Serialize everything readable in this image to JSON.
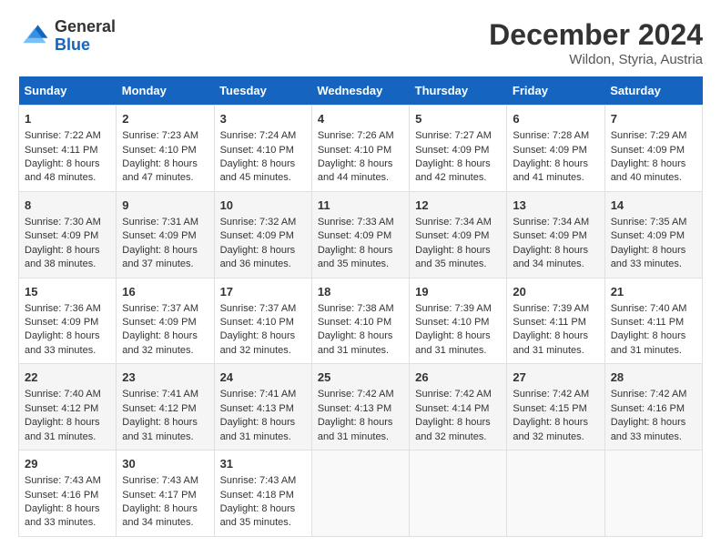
{
  "header": {
    "logo_line1": "General",
    "logo_line2": "Blue",
    "title": "December 2024",
    "subtitle": "Wildon, Styria, Austria"
  },
  "days_of_week": [
    "Sunday",
    "Monday",
    "Tuesday",
    "Wednesday",
    "Thursday",
    "Friday",
    "Saturday"
  ],
  "weeks": [
    [
      {
        "day": "1",
        "sunrise": "7:22 AM",
        "sunset": "4:11 PM",
        "daylight": "8 hours and 48 minutes."
      },
      {
        "day": "2",
        "sunrise": "7:23 AM",
        "sunset": "4:10 PM",
        "daylight": "8 hours and 47 minutes."
      },
      {
        "day": "3",
        "sunrise": "7:24 AM",
        "sunset": "4:10 PM",
        "daylight": "8 hours and 45 minutes."
      },
      {
        "day": "4",
        "sunrise": "7:26 AM",
        "sunset": "4:10 PM",
        "daylight": "8 hours and 44 minutes."
      },
      {
        "day": "5",
        "sunrise": "7:27 AM",
        "sunset": "4:09 PM",
        "daylight": "8 hours and 42 minutes."
      },
      {
        "day": "6",
        "sunrise": "7:28 AM",
        "sunset": "4:09 PM",
        "daylight": "8 hours and 41 minutes."
      },
      {
        "day": "7",
        "sunrise": "7:29 AM",
        "sunset": "4:09 PM",
        "daylight": "8 hours and 40 minutes."
      }
    ],
    [
      {
        "day": "8",
        "sunrise": "7:30 AM",
        "sunset": "4:09 PM",
        "daylight": "8 hours and 38 minutes."
      },
      {
        "day": "9",
        "sunrise": "7:31 AM",
        "sunset": "4:09 PM",
        "daylight": "8 hours and 37 minutes."
      },
      {
        "day": "10",
        "sunrise": "7:32 AM",
        "sunset": "4:09 PM",
        "daylight": "8 hours and 36 minutes."
      },
      {
        "day": "11",
        "sunrise": "7:33 AM",
        "sunset": "4:09 PM",
        "daylight": "8 hours and 35 minutes."
      },
      {
        "day": "12",
        "sunrise": "7:34 AM",
        "sunset": "4:09 PM",
        "daylight": "8 hours and 35 minutes."
      },
      {
        "day": "13",
        "sunrise": "7:34 AM",
        "sunset": "4:09 PM",
        "daylight": "8 hours and 34 minutes."
      },
      {
        "day": "14",
        "sunrise": "7:35 AM",
        "sunset": "4:09 PM",
        "daylight": "8 hours and 33 minutes."
      }
    ],
    [
      {
        "day": "15",
        "sunrise": "7:36 AM",
        "sunset": "4:09 PM",
        "daylight": "8 hours and 33 minutes."
      },
      {
        "day": "16",
        "sunrise": "7:37 AM",
        "sunset": "4:09 PM",
        "daylight": "8 hours and 32 minutes."
      },
      {
        "day": "17",
        "sunrise": "7:37 AM",
        "sunset": "4:10 PM",
        "daylight": "8 hours and 32 minutes."
      },
      {
        "day": "18",
        "sunrise": "7:38 AM",
        "sunset": "4:10 PM",
        "daylight": "8 hours and 31 minutes."
      },
      {
        "day": "19",
        "sunrise": "7:39 AM",
        "sunset": "4:10 PM",
        "daylight": "8 hours and 31 minutes."
      },
      {
        "day": "20",
        "sunrise": "7:39 AM",
        "sunset": "4:11 PM",
        "daylight": "8 hours and 31 minutes."
      },
      {
        "day": "21",
        "sunrise": "7:40 AM",
        "sunset": "4:11 PM",
        "daylight": "8 hours and 31 minutes."
      }
    ],
    [
      {
        "day": "22",
        "sunrise": "7:40 AM",
        "sunset": "4:12 PM",
        "daylight": "8 hours and 31 minutes."
      },
      {
        "day": "23",
        "sunrise": "7:41 AM",
        "sunset": "4:12 PM",
        "daylight": "8 hours and 31 minutes."
      },
      {
        "day": "24",
        "sunrise": "7:41 AM",
        "sunset": "4:13 PM",
        "daylight": "8 hours and 31 minutes."
      },
      {
        "day": "25",
        "sunrise": "7:42 AM",
        "sunset": "4:13 PM",
        "daylight": "8 hours and 31 minutes."
      },
      {
        "day": "26",
        "sunrise": "7:42 AM",
        "sunset": "4:14 PM",
        "daylight": "8 hours and 32 minutes."
      },
      {
        "day": "27",
        "sunrise": "7:42 AM",
        "sunset": "4:15 PM",
        "daylight": "8 hours and 32 minutes."
      },
      {
        "day": "28",
        "sunrise": "7:42 AM",
        "sunset": "4:16 PM",
        "daylight": "8 hours and 33 minutes."
      }
    ],
    [
      {
        "day": "29",
        "sunrise": "7:43 AM",
        "sunset": "4:16 PM",
        "daylight": "8 hours and 33 minutes."
      },
      {
        "day": "30",
        "sunrise": "7:43 AM",
        "sunset": "4:17 PM",
        "daylight": "8 hours and 34 minutes."
      },
      {
        "day": "31",
        "sunrise": "7:43 AM",
        "sunset": "4:18 PM",
        "daylight": "8 hours and 35 minutes."
      },
      null,
      null,
      null,
      null
    ]
  ]
}
